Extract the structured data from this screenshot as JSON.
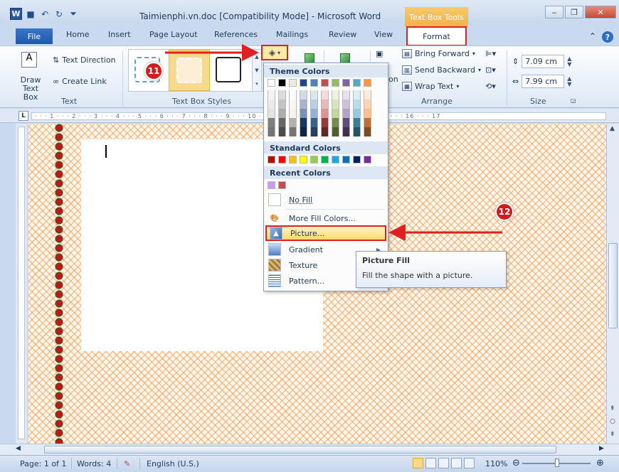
{
  "window": {
    "title": "Taimienphi.vn.doc [Compatibility Mode]  -  Microsoft Word",
    "contextual_tab_group": "Text Box Tools",
    "app_icon": "W",
    "qat_icons": [
      "save-icon",
      "undo-icon",
      "redo-icon",
      "customize-icon"
    ],
    "controls": [
      "minimize",
      "restore",
      "close"
    ]
  },
  "tabs": [
    "File",
    "Home",
    "Insert",
    "Page Layout",
    "References",
    "Mailings",
    "Review",
    "View",
    "Format"
  ],
  "ribbon": {
    "text_group": {
      "draw_text_box": "Draw\nText Box",
      "text_direction": "Text Direction",
      "create_link": "Create Link",
      "label": "Text"
    },
    "styles_group": {
      "label": "Text Box Styles"
    },
    "arrange_group": {
      "bring_forward": "Bring Forward",
      "send_backward": "Send Backward",
      "wrap_text": "Wrap Text",
      "position_fragment": "on",
      "label": "Arrange"
    },
    "size_group": {
      "height": "7.09 cm",
      "width": "7.99 cm",
      "label": "Size"
    }
  },
  "ruler": {
    "text": "· · · 1 · · · 2 · · · 3 · · · 4 · · · 5 · · · 6 · · · 7 · · · 8 · · · 9 · · · 10 · · · 11 · · · 12 · · · 13 · · · 14 · · · 15 · · · 16 · · · 17"
  },
  "fill_menu": {
    "theme_colors_label": "Theme Colors",
    "theme_colors": [
      "#ffffff",
      "#000000",
      "#eeece1",
      "#1f497d",
      "#4f81bd",
      "#c0504d",
      "#9bbb59",
      "#8064a2",
      "#4bacc6",
      "#f79646"
    ],
    "standard_colors_label": "Standard Colors",
    "standard_colors": [
      "#c00000",
      "#ff0000",
      "#ffc000",
      "#ffff00",
      "#92d050",
      "#00b050",
      "#00b0f0",
      "#0070c0",
      "#002060",
      "#7030a0"
    ],
    "recent_colors_label": "Recent Colors",
    "recent_colors": [
      "#cc99ff",
      "#c0504d"
    ],
    "items": [
      {
        "label": "No Fill",
        "icon": "no-fill-icon"
      },
      {
        "label": "More Fill Colors...",
        "icon": "palette-icon"
      },
      {
        "label": "Picture...",
        "icon": "picture-icon",
        "highlighted": true
      },
      {
        "label": "Gradient",
        "icon": "gradient-icon",
        "submenu": true
      },
      {
        "label": "Texture",
        "icon": "texture-icon",
        "submenu": true
      },
      {
        "label": "Pattern...",
        "icon": "pattern-icon"
      }
    ]
  },
  "tooltip": {
    "title": "Picture Fill",
    "body": "Fill the shape with a picture."
  },
  "annotations": {
    "step_11": "11",
    "step_12": "12"
  },
  "status_bar": {
    "page": "Page: 1 of 1",
    "words": "Words: 4",
    "language": "English (U.S.)",
    "zoom": "110%"
  },
  "colors": {
    "highlight_red": "#e02020",
    "accent_blue": "#2a5699",
    "page_pattern": "#f0a060"
  }
}
